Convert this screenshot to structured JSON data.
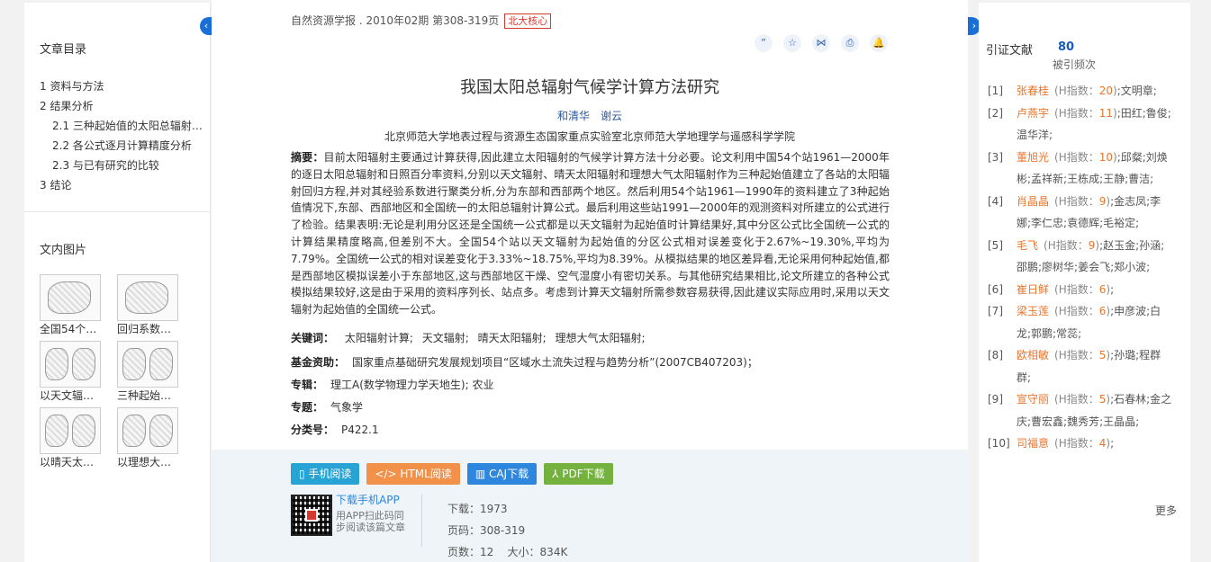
{
  "left": {
    "toc_title": "文章目录",
    "toc": [
      {
        "label": "1 资料与方法",
        "sub": false
      },
      {
        "label": "2 结果分析",
        "sub": false
      },
      {
        "label": "2.1 三种起始值的太阳总辐射…",
        "sub": true
      },
      {
        "label": "2.2 各公式逐月计算精度分析",
        "sub": true
      },
      {
        "label": "2.3 与已有研究的比较",
        "sub": true
      },
      {
        "label": "3 结论",
        "sub": false
      }
    ],
    "fig_title": "文内图片",
    "figures": [
      {
        "caption": "全国54个日…"
      },
      {
        "caption": "回归系数聚…"
      },
      {
        "caption": "以天文辐射…"
      },
      {
        "caption": "三种起始值…"
      },
      {
        "caption": "以晴天太阳…"
      },
      {
        "caption": "以理想大气…"
      }
    ]
  },
  "toggles": {
    "left": "‹",
    "right": "›"
  },
  "article": {
    "source": "自然资源学报 . 2010年02期   第308-319页",
    "badge": "北大核心",
    "tool_icons": [
      "”",
      "☆",
      "⋈",
      "⎙",
      "🔔"
    ],
    "title": "我国太阳总辐射气候学计算方法研究",
    "authors": [
      "和清华",
      "谢云"
    ],
    "affiliation": "北京师范大学地表过程与资源生态国家重点实验室北京师范大学地理学与遥感科学学院",
    "abstract_label": "摘要：",
    "abstract": "目前太阳辐射主要通过计算获得,因此建立太阳辐射的气候学计算方法十分必要。论文利用中国54个站1961—2000年的逐日太阳总辐射和日照百分率资料,分别以天文辐射、晴天太阳辐射和理想大气太阳辐射作为三种起始值建立了各站的太阳辐射回归方程,并对其经验系数进行聚类分析,分为东部和西部两个地区。然后利用54个站1961—1990年的资料建立了3种起始值情况下,东部、西部地区和全国统一的太阳总辐射计算公式。最后利用这些站1991—2000年的观测资料对所建立的公式进行了检验。结果表明:无论是利用分区还是全国统一公式都是以天文辐射为起始值时计算结果好,其中分区公式比全国统一公式的计算结果精度略高,但差别不大。全国54个站以天文辐射为起始值的分区公式相对误差变化于2.67%~19.30%,平均为7.79%。全国统一公式的相对误差变化于3.33%~18.75%,平均为8.39%。从模拟结果的地区差异看,无论采用何种起始值,都是西部地区模拟误差小于东部地区,这与西部地区干燥、空气湿度小有密切关系。与其他研究结果相比,论文所建立的各种公式模拟结果较好,这是由于采用的资料序列长、站点多。考虑到计算天文辐射所需参数容易获得,因此建议实际应用时,采用以天文辐射为起始值的全国统一公式。",
    "keywords_label": "关键词：",
    "keywords": [
      "太阳辐射计算;",
      "天文辐射;",
      "晴天太阳辐射;",
      "理想大气太阳辐射;"
    ],
    "fund_label": "基金资助：",
    "fund": "国家重点基础研究发展规划项目“区域水土流失过程与趋势分析”(2007CB407203)；",
    "special_label": "专辑：",
    "special": "理工A(数学物理力学天地生); 农业",
    "topic_label": "专题：",
    "topic": "气象学",
    "class_label": "分类号：",
    "class": "P422.1"
  },
  "downloads": {
    "phone": "手机阅读",
    "html": "HTML阅读",
    "caj": "CAJ下载",
    "pdf": "PDF下载",
    "app_link": "下载手机APP",
    "app_desc": "用APP扫此码同步阅读该篇文章",
    "stats": {
      "downloads": "下载：1973",
      "pages": "页码：308-319",
      "pagecount": "页数：12",
      "size": "大小：834K"
    }
  },
  "citations": {
    "title": "引证文献",
    "count": "80",
    "sub": "被引频次",
    "more": "更多",
    "h_label": "(H指数：",
    "refs": [
      {
        "num": "[1]",
        "name": "张春桂",
        "h": "20",
        "rest": ";文明章;"
      },
      {
        "num": "[2]",
        "name": "卢燕宇",
        "h": "11",
        "rest": ";田红;鲁俊;温华洋;"
      },
      {
        "num": "[3]",
        "name": "董旭光",
        "h": "10",
        "rest": ";邱粲;刘焕彬;孟祥新;王栋成;王静;曹洁;"
      },
      {
        "num": "[4]",
        "name": "肖晶晶",
        "h": "9",
        "rest": ";金志凤;李娜;李仁忠;袁德辉;毛裕定;"
      },
      {
        "num": "[5]",
        "name": "毛飞",
        "h": "9",
        "rest": ";赵玉金;孙涵;邵鹏;廖树华;姜会飞;郑小波;"
      },
      {
        "num": "[6]",
        "name": "崔日鲜",
        "h": "6",
        "rest": ";"
      },
      {
        "num": "[7]",
        "name": "梁玉莲",
        "h": "6",
        "rest": ";申彦波;白龙;郭鹏;常蕊;"
      },
      {
        "num": "[8]",
        "name": "欧相敏",
        "h": "5",
        "rest": ";孙璐;程群群;"
      },
      {
        "num": "[9]",
        "name": "宣守丽",
        "h": "5",
        "rest": ";石春林;金之庆;曹宏鑫;魏秀芳;王晶晶;"
      },
      {
        "num": "[10]",
        "name": "司福意",
        "h": "4",
        "rest": ";"
      }
    ]
  }
}
